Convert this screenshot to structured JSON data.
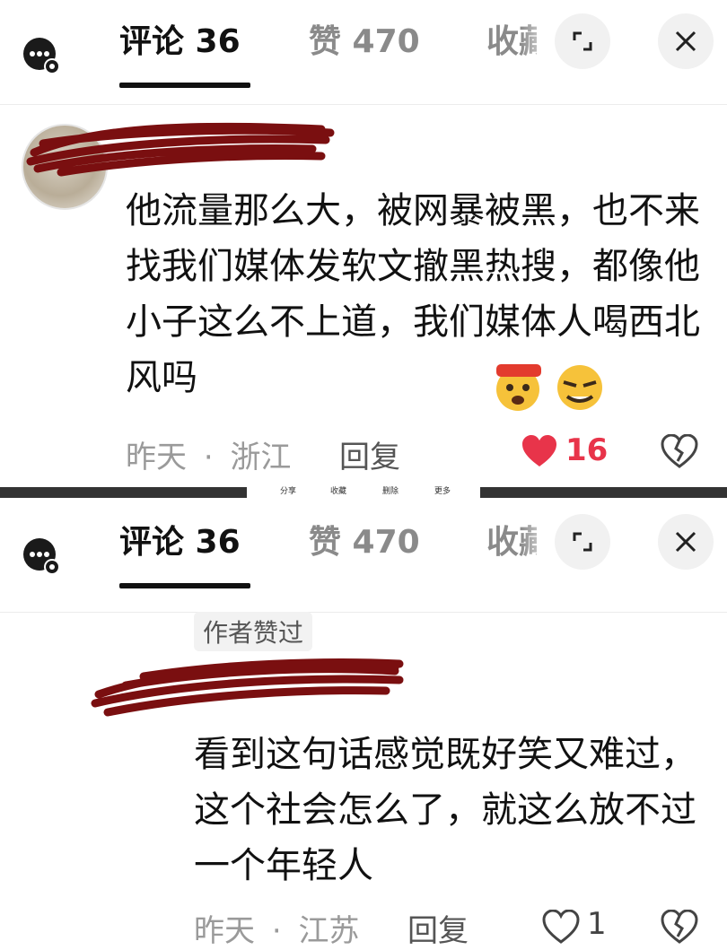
{
  "tabs": {
    "comments": "评论 36",
    "likes": "赞 470",
    "favorites": "收藏"
  },
  "separator": {
    "share": "分享",
    "favorite": "收藏",
    "delete": "删除",
    "more": "更多"
  },
  "comment1": {
    "text": "他流量那么大，被网暴被黑，也不来找我们媒体发软文撤黑热搜，都像他小子这么不上道，我们媒体人喝西北风吗",
    "time": "昨天",
    "location": "浙江",
    "meta_sep": "·",
    "reply": "回复",
    "likes": "16"
  },
  "comment2": {
    "badge": "作者赞过",
    "text": "看到这句话感觉既好笑又难过，这个社会怎么了，就这么放不过一个年轻人",
    "time": "昨天",
    "location": "江苏",
    "meta_sep": "·",
    "reply": "回复",
    "likes": "1"
  },
  "colors": {
    "heart_red": "#e8344a",
    "scribble_red": "#7a0f10",
    "muted": "#9a9a9a"
  }
}
